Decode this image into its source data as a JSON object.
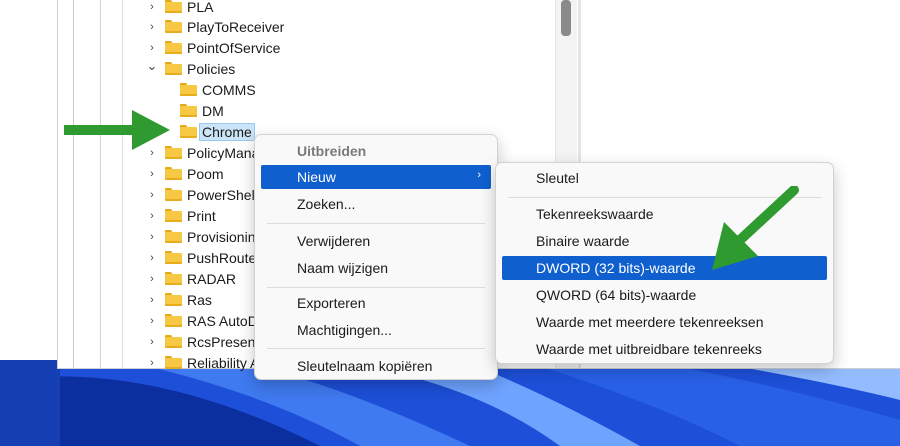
{
  "tree": {
    "items": [
      {
        "label": "PLA",
        "level": 1,
        "expander": "collapsed"
      },
      {
        "label": "PlayToReceiver",
        "level": 1,
        "expander": "collapsed"
      },
      {
        "label": "PointOfService",
        "level": 1,
        "expander": "collapsed"
      },
      {
        "label": "Policies",
        "level": 1,
        "expander": "expanded"
      },
      {
        "label": "COMMS",
        "level": 2,
        "expander": "none"
      },
      {
        "label": "DM",
        "level": 2,
        "expander": "none"
      },
      {
        "label": "Chrome",
        "level": 2,
        "expander": "none",
        "selected": true
      },
      {
        "label": "PolicyMana",
        "level": 1,
        "expander": "collapsed"
      },
      {
        "label": "Poom",
        "level": 1,
        "expander": "collapsed"
      },
      {
        "label": "PowerShell",
        "level": 1,
        "expander": "collapsed"
      },
      {
        "label": "Print",
        "level": 1,
        "expander": "collapsed"
      },
      {
        "label": "Provisionin",
        "level": 1,
        "expander": "collapsed"
      },
      {
        "label": "PushRoute",
        "level": 1,
        "expander": "collapsed"
      },
      {
        "label": "RADAR",
        "level": 1,
        "expander": "collapsed"
      },
      {
        "label": "Ras",
        "level": 1,
        "expander": "collapsed"
      },
      {
        "label": "RAS AutoD",
        "level": 1,
        "expander": "collapsed"
      },
      {
        "label": "RcsPresen",
        "level": 1,
        "expander": "collapsed"
      },
      {
        "label": "Reliability A",
        "level": 1,
        "expander": "collapsed"
      }
    ]
  },
  "context_menu": {
    "items": [
      {
        "label": "Uitbreiden",
        "disabled": true
      },
      {
        "label": "Nieuw",
        "highlighted": true,
        "has_submenu": true
      },
      {
        "label": "Zoeken..."
      },
      {
        "label": "Verwijderen"
      },
      {
        "label": "Naam wijzigen"
      },
      {
        "label": "Exporteren"
      },
      {
        "label": "Machtigingen..."
      },
      {
        "label": "Sleutelnaam kopiëren"
      }
    ]
  },
  "submenu": {
    "items": [
      {
        "label": "Sleutel"
      },
      {
        "label": "Tekenreekswaarde"
      },
      {
        "label": "Binaire waarde"
      },
      {
        "label": "DWORD (32 bits)-waarde",
        "highlighted": true
      },
      {
        "label": "QWORD (64 bits)-waarde"
      },
      {
        "label": "Waarde met meerdere tekenreeksen"
      },
      {
        "label": "Waarde met uitbreidbare tekenreeks"
      }
    ]
  },
  "colors": {
    "highlight": "#0f5fcf",
    "arrow": "#2f9a2f",
    "folder": "#f6c843",
    "selection": "#cce4f7"
  },
  "icons": {
    "chevron_collapsed": "›",
    "chevron_expanded": "⌄",
    "submenu_arrow": "›"
  }
}
